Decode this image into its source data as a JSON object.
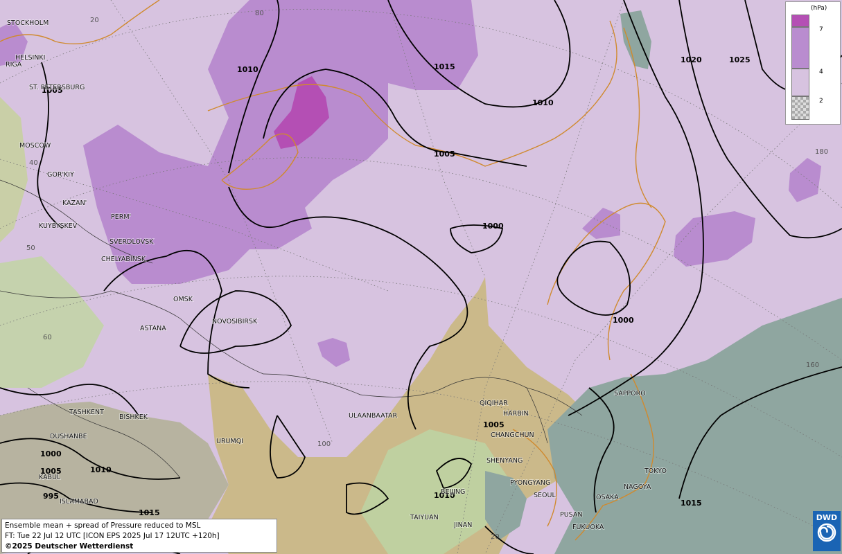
{
  "map": {
    "cities": [
      {
        "name": "STOCKHOLM"
      },
      {
        "name": "HELSINKI"
      },
      {
        "name": "RIGA"
      },
      {
        "name": "ST. PETERSBURG"
      },
      {
        "name": "MOSCOW"
      },
      {
        "name": "GOR'KIY"
      },
      {
        "name": "KAZAN'"
      },
      {
        "name": "KUYBYSKEV"
      },
      {
        "name": "PERM'"
      },
      {
        "name": "SVERDLOVSK"
      },
      {
        "name": "CHELYABINSK"
      },
      {
        "name": "OMSK"
      },
      {
        "name": "ASTANA"
      },
      {
        "name": "NOVOSIBIRSK"
      },
      {
        "name": "TASHKENT"
      },
      {
        "name": "BISHKEK"
      },
      {
        "name": "DUSHANBE"
      },
      {
        "name": "KABUL"
      },
      {
        "name": "ISLAMABAD"
      },
      {
        "name": "URUMQI"
      },
      {
        "name": "ULAANBAATAR"
      },
      {
        "name": "QIQIHAR"
      },
      {
        "name": "HARBIN"
      },
      {
        "name": "CHANGCHUN"
      },
      {
        "name": "SHENYANG"
      },
      {
        "name": "PYONGYANG"
      },
      {
        "name": "SEOUL"
      },
      {
        "name": "BEIJING"
      },
      {
        "name": "TAIYUAN"
      },
      {
        "name": "JINAN"
      },
      {
        "name": "PUSAN"
      },
      {
        "name": "FUKUOKA"
      },
      {
        "name": "OSAKA"
      },
      {
        "name": "NAGOYA"
      },
      {
        "name": "TOKYO"
      },
      {
        "name": "SAPPORO"
      }
    ],
    "isobar_labels": [
      {
        "value": "1010"
      },
      {
        "value": "1015"
      },
      {
        "value": "1010"
      },
      {
        "value": "1020"
      },
      {
        "value": "1025"
      },
      {
        "value": "1005"
      },
      {
        "value": "1005"
      },
      {
        "value": "1000"
      },
      {
        "value": "1000"
      },
      {
        "value": "1005"
      },
      {
        "value": "1000"
      },
      {
        "value": "1005"
      },
      {
        "value": "1010"
      },
      {
        "value": "995"
      },
      {
        "value": "1015"
      },
      {
        "value": "1010"
      },
      {
        "value": "1015"
      }
    ],
    "grid_labels": [
      {
        "text": "20"
      },
      {
        "text": "80"
      },
      {
        "text": "40"
      },
      {
        "text": "50"
      },
      {
        "text": "60"
      },
      {
        "text": "100"
      },
      {
        "text": "180"
      },
      {
        "text": "160"
      },
      {
        "text": "20"
      }
    ],
    "colors": {
      "spread_low": "#d7c3e0",
      "spread_mid": "#b98ccf",
      "spread_high": "#b44fb4",
      "sea": "#8fa6a0",
      "land_relief": "#c8b98a",
      "isobar": "#000000",
      "coast": "#d08a2e"
    }
  },
  "legend": {
    "unit": "(hPa)",
    "levels": [
      "7",
      "4",
      "2"
    ],
    "colors": [
      "#b44fb4",
      "#b98ccf",
      "#d7c3e0"
    ]
  },
  "info": {
    "line1": "Ensemble mean + spread of Pressure reduced to MSL",
    "line2": "FT: Tue 22 Jul 12 UTC [ICON EPS 2025 Jul 17 12UTC +120h]",
    "line3": "©2025 Deutscher Wetterdienst"
  },
  "logo": {
    "text": "DWD"
  }
}
